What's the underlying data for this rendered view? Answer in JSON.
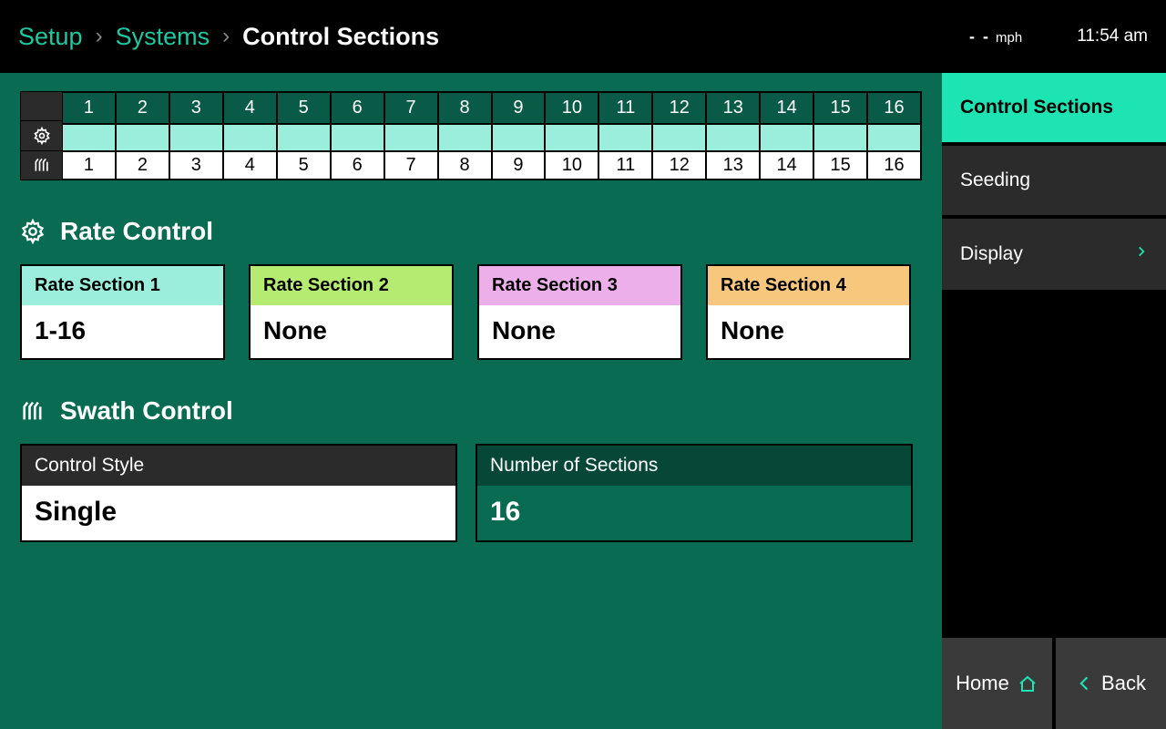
{
  "topbar": {
    "breadcrumb": [
      "Setup",
      "Systems",
      "Control Sections"
    ],
    "speed_value": "- -",
    "speed_unit": "mph",
    "time": "11:54 am"
  },
  "strip": {
    "top_numbers": [
      "1",
      "2",
      "3",
      "4",
      "5",
      "6",
      "7",
      "8",
      "9",
      "10",
      "11",
      "12",
      "13",
      "14",
      "15",
      "16"
    ],
    "bottom_numbers": [
      "1",
      "2",
      "3",
      "4",
      "5",
      "6",
      "7",
      "8",
      "9",
      "10",
      "11",
      "12",
      "13",
      "14",
      "15",
      "16"
    ]
  },
  "rate_control": {
    "title": "Rate Control",
    "sections": [
      {
        "label": "Rate Section 1",
        "value": "1-16",
        "color": "#9CEEDC"
      },
      {
        "label": "Rate Section 2",
        "value": "None",
        "color": "#B6EB72"
      },
      {
        "label": "Rate Section 3",
        "value": "None",
        "color": "#EDAFE9"
      },
      {
        "label": "Rate Section 4",
        "value": "None",
        "color": "#F7C77E"
      }
    ]
  },
  "swath_control": {
    "title": "Swath Control",
    "control_style": {
      "label": "Control Style",
      "value": "Single"
    },
    "num_sections": {
      "label": "Number of Sections",
      "value": "16"
    }
  },
  "side": {
    "tabs": [
      {
        "label": "Control Sections",
        "active": true,
        "has_chevron": false
      },
      {
        "label": "Seeding",
        "active": false,
        "has_chevron": false
      },
      {
        "label": "Display",
        "active": false,
        "has_chevron": true
      }
    ],
    "home_label": "Home",
    "back_label": "Back"
  }
}
